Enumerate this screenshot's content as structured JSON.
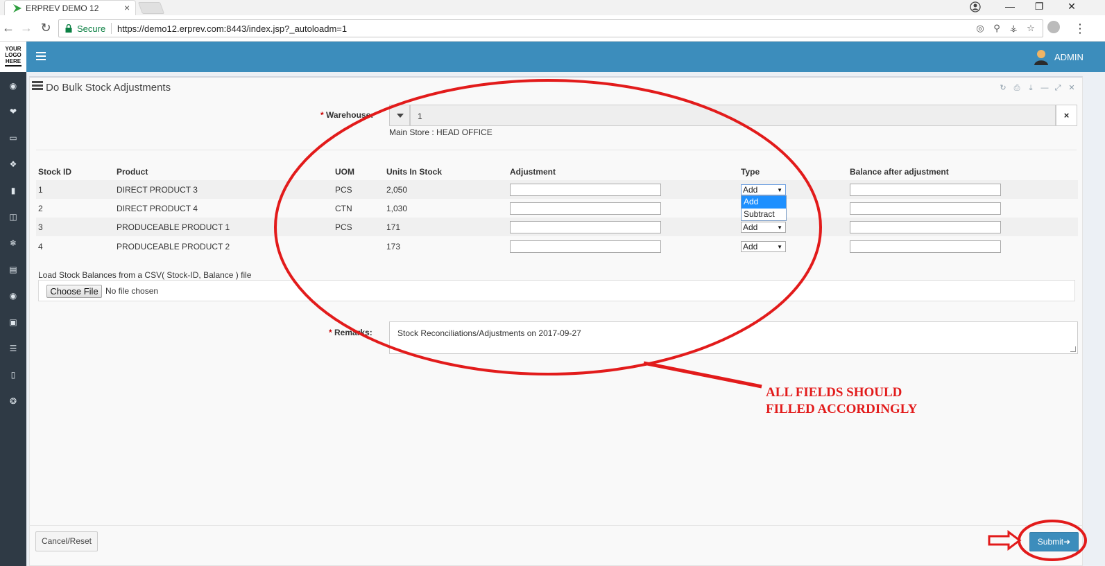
{
  "browser": {
    "tab_title": "ERPREV DEMO 12",
    "tab_close": "×",
    "secure_label": "Secure",
    "url": "https://demo12.erprev.com:8443/index.jsp?_autoloadm=1",
    "window_controls": {
      "minimize": "—",
      "restore": "❐",
      "close": "✕"
    }
  },
  "logo": {
    "line1": "YOUR",
    "line2": "LOGO",
    "line3": "HERE"
  },
  "header": {
    "user_name": "ADMIN"
  },
  "sidebar_icons": [
    "dashboard-icon",
    "tag-icon",
    "money-icon",
    "cubes-icon",
    "book-icon",
    "trash-icon",
    "snowflake-icon",
    "cart-icon",
    "disc-icon",
    "monitor-icon",
    "database-icon",
    "notebook-icon",
    "lifebuoy-icon"
  ],
  "panel": {
    "title": "Do Bulk Stock Adjustments",
    "tools": [
      "refresh-icon",
      "print-icon",
      "download-icon",
      "minimize-icon",
      "expand-icon",
      "close-icon"
    ]
  },
  "warehouse": {
    "required_mark": "*",
    "label": "Warehouse:",
    "value": "1",
    "description": "Main Store : HEAD OFFICE",
    "clear_label": "×"
  },
  "table": {
    "headers": [
      "Stock ID",
      "Product",
      "UOM",
      "Units In Stock",
      "Adjustment",
      "Type",
      "Balance after adjustment"
    ],
    "rows": [
      {
        "stock_id": "1",
        "product": "DIRECT PRODUCT 3",
        "uom": "PCS",
        "units": "2,050",
        "adjustment": "",
        "type": "Add",
        "balance": ""
      },
      {
        "stock_id": "2",
        "product": "DIRECT PRODUCT 4",
        "uom": "CTN",
        "units": "1,030",
        "adjustment": "",
        "type": "Add",
        "balance": ""
      },
      {
        "stock_id": "3",
        "product": "PRODUCEABLE PRODUCT 1",
        "uom": "PCS",
        "units": "171",
        "adjustment": "",
        "type": "Add",
        "balance": ""
      },
      {
        "stock_id": "4",
        "product": "PRODUCEABLE PRODUCT 2",
        "uom": "",
        "units": "173",
        "adjustment": "",
        "type": "Add",
        "balance": ""
      }
    ],
    "type_options": [
      "Add",
      "Subtract"
    ],
    "open_dropdown_highlighted": "Add"
  },
  "csv": {
    "label": "Load Stock Balances from a CSV( Stock-ID, Balance ) file",
    "button": "Choose File",
    "status": "No file chosen"
  },
  "remarks": {
    "required_mark": "*",
    "label": "Remarks:",
    "value": "Stock Reconciliations/Adjustments on 2017-09-27"
  },
  "footer": {
    "cancel": "Cancel/Reset",
    "submit": "Submit"
  },
  "annotation": {
    "line1": "ALL FIELDS SHOULD",
    "line2": "FILLED ACCORDINGLY",
    "color": "#e21b1b"
  },
  "colors": {
    "header": "#3c8dbc",
    "sidebar": "#2f3a45",
    "accent_selected": "#1e90ff"
  }
}
